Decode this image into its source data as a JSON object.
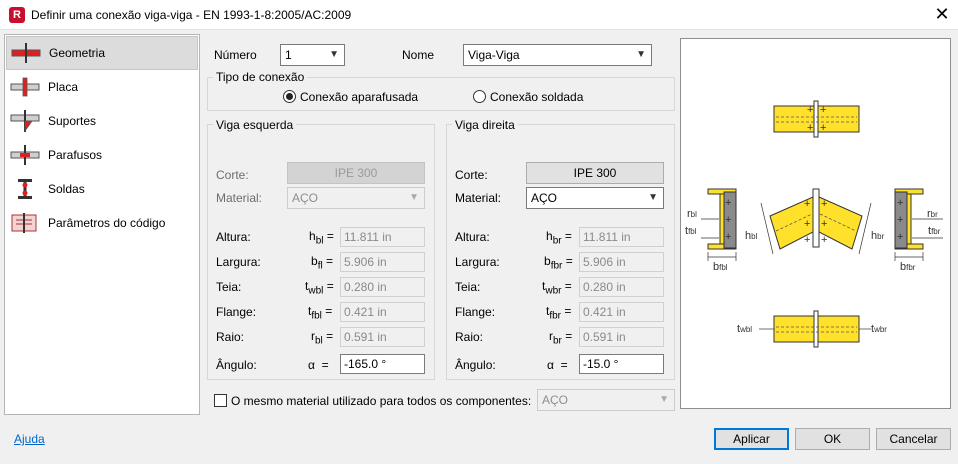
{
  "window": {
    "title": "Definir uma conexão viga-viga - EN 1993-1-8:2005/AC:2009",
    "app_icon": "R"
  },
  "sidebar": {
    "items": [
      {
        "label": "Geometria",
        "icon": "geometry-icon",
        "selected": true
      },
      {
        "label": "Placa",
        "icon": "plate-icon"
      },
      {
        "label": "Suportes",
        "icon": "supports-icon"
      },
      {
        "label": "Parafusos",
        "icon": "bolts-icon"
      },
      {
        "label": "Soldas",
        "icon": "welds-icon"
      },
      {
        "label": "Parâmetros do código",
        "icon": "code-parameters-icon"
      }
    ]
  },
  "top": {
    "numero_label": "Número",
    "numero_value": "1",
    "nome_label": "Nome",
    "nome_value": "Viga-Viga"
  },
  "tipo": {
    "title": "Tipo de conexão",
    "bolted": "Conexão aparafusada",
    "welded": "Conexão soldada",
    "selected": "bolted"
  },
  "left_beam": {
    "title": "Viga esquerda",
    "corte_label": "Corte:",
    "corte_value": "IPE 300",
    "material_label": "Material:",
    "material_value": "AÇO",
    "rows": [
      {
        "label": "Altura:",
        "sym": "h",
        "sub": "bl",
        "value": "11.811 in"
      },
      {
        "label": "Largura:",
        "sym": "b",
        "sub": "fl",
        "value": "5.906 in"
      },
      {
        "label": "Teia:",
        "sym": "t",
        "sub": "wbl",
        "value": "0.280 in"
      },
      {
        "label": "Flange:",
        "sym": "t",
        "sub": "fbl",
        "value": "0.421 in"
      },
      {
        "label": "Raio:",
        "sym": "r",
        "sub": "bl",
        "value": "0.591 in"
      }
    ],
    "angle_label": "Ângulo:",
    "angle_sym": "α",
    "angle_value": "-165.0 °"
  },
  "right_beam": {
    "title": "Viga direita",
    "corte_label": "Corte:",
    "corte_value": "IPE 300",
    "material_label": "Material:",
    "material_value": "AÇO",
    "rows": [
      {
        "label": "Altura:",
        "sym": "h",
        "sub": "br",
        "value": "11.811 in"
      },
      {
        "label": "Largura:",
        "sym": "b",
        "sub": "fbr",
        "value": "5.906 in"
      },
      {
        "label": "Teia:",
        "sym": "t",
        "sub": "wbr",
        "value": "0.280 in"
      },
      {
        "label": "Flange:",
        "sym": "t",
        "sub": "fbr",
        "value": "0.421 in"
      },
      {
        "label": "Raio:",
        "sym": "r",
        "sub": "br",
        "value": "0.591 in"
      }
    ],
    "angle_label": "Ângulo:",
    "angle_sym": "α",
    "angle_value": "-15.0 °"
  },
  "same_material": {
    "label": "O mesmo material utilizado para todos os componentes:",
    "value": "AÇO",
    "checked": false
  },
  "preview": {
    "labels": {
      "rbl": "r",
      "rbl_sub": "bl",
      "tfbl": "t",
      "tfbl_sub": "fbl",
      "hbl": "h",
      "hbl_sub": "bl",
      "bfbl": "b",
      "bfbl_sub": "fbl",
      "hbr": "h",
      "hbr_sub": "br",
      "rbr": "r",
      "rbr_sub": "br",
      "tfbr": "t",
      "tfbr_sub": "fbr",
      "bfbr": "b",
      "bfbr_sub": "fbr",
      "twbl": "t",
      "twbl_sub": "wbl",
      "twbr": "t",
      "twbr_sub": "wbr"
    },
    "colors": {
      "steel": "#ffe02a",
      "outline": "#333333",
      "profile": "#8a8a8a"
    }
  },
  "footer": {
    "help": "Ajuda",
    "apply": "Aplicar",
    "ok": "OK",
    "cancel": "Cancelar"
  },
  "colors": {
    "accent": "#0078d7",
    "selected_bg": "#dcdcdc"
  }
}
